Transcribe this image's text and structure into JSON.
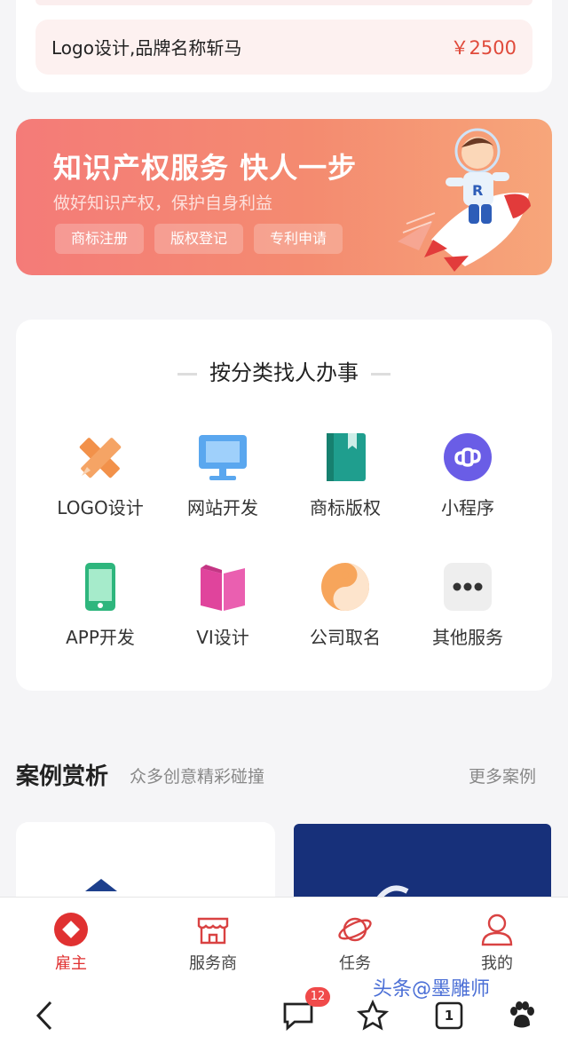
{
  "order": {
    "title": "Logo设计,品牌名称斩马",
    "price": "￥2500"
  },
  "banner": {
    "title": "知识产权服务 快人一步",
    "subtitle": "做好知识产权，保护自身利益",
    "pills": [
      "商标注册",
      "版权登记",
      "专利申请"
    ]
  },
  "categories": {
    "title": "按分类找人办事",
    "items": [
      {
        "label": "LOGO设计",
        "icon": "pencil-ruler-icon"
      },
      {
        "label": "网站开发",
        "icon": "monitor-icon"
      },
      {
        "label": "商标版权",
        "icon": "book-icon"
      },
      {
        "label": "小程序",
        "icon": "mini-program-icon"
      },
      {
        "label": "APP开发",
        "icon": "phone-icon"
      },
      {
        "label": "VI设计",
        "icon": "open-book-icon"
      },
      {
        "label": "公司取名",
        "icon": "yin-yang-icon"
      },
      {
        "label": "其他服务",
        "icon": "more-icon"
      }
    ]
  },
  "cases": {
    "title": "案例赏析",
    "subtitle": "众多创意精彩碰撞",
    "more": "更多案例"
  },
  "tabbar": {
    "active": "雇主",
    "items": [
      {
        "label": "雇主",
        "icon": "employer-icon"
      },
      {
        "label": "服务商",
        "icon": "shop-icon"
      },
      {
        "label": "任务",
        "icon": "planet-icon"
      },
      {
        "label": "我的",
        "icon": "user-icon"
      }
    ]
  },
  "system_bar": {
    "watermark": "头条@墨雕师",
    "comments_badge": "12",
    "tabs_count": "1"
  },
  "colors": {
    "accent": "#e03131",
    "banner": "#f47b78",
    "price": "#e04a3b"
  }
}
